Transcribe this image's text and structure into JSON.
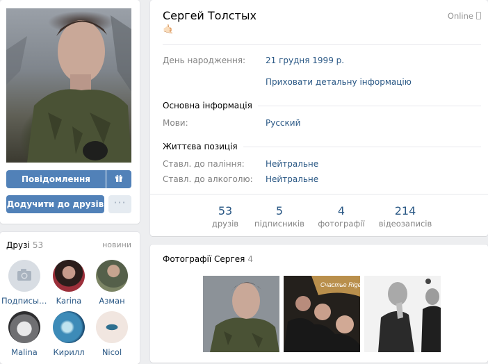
{
  "profile": {
    "name": "Сергей Толстых",
    "status_emoji": "🤙🏻",
    "online": "Online",
    "birthday_label": "День народження:",
    "birthday_value": "21 грудня 1999 р.",
    "hide_details_link": "Приховати детальну інформацію",
    "section_basic": "Основна інформація",
    "languages_label": "Мови:",
    "languages_value": "Русский",
    "section_life": "Життєва позиція",
    "smoking_label": "Ставл. до паління:",
    "smoking_value": "Нейтральне",
    "alcohol_label": "Ставл. до алкоголю:",
    "alcohol_value": "Нейтральне"
  },
  "actions": {
    "message_label": "Повідомлення",
    "add_friend_label": "Додучити до друзів",
    "more_label": "···",
    "gift_icon": "gift-icon"
  },
  "stats": [
    {
      "num": "53",
      "cap": "друзів"
    },
    {
      "num": "5",
      "cap": "підписників"
    },
    {
      "num": "4",
      "cap": "фотографії"
    },
    {
      "num": "214",
      "cap": "відеозаписів"
    }
  ],
  "friends": {
    "title": "Друзі",
    "count": "53",
    "news": "новини",
    "items": [
      {
        "name": "Подписыв..."
      },
      {
        "name": "Karina"
      },
      {
        "name": "Азман"
      },
      {
        "name": "Malina"
      },
      {
        "name": "Кирилл"
      },
      {
        "name": "Nicol"
      }
    ]
  },
  "photos": {
    "title": "Фотографії Сергея",
    "count": "4",
    "thumb_text": "Счастье Rigen!"
  },
  "colors": {
    "accent": "#5181b8",
    "link": "#2a5885",
    "background": "#edeef0"
  }
}
